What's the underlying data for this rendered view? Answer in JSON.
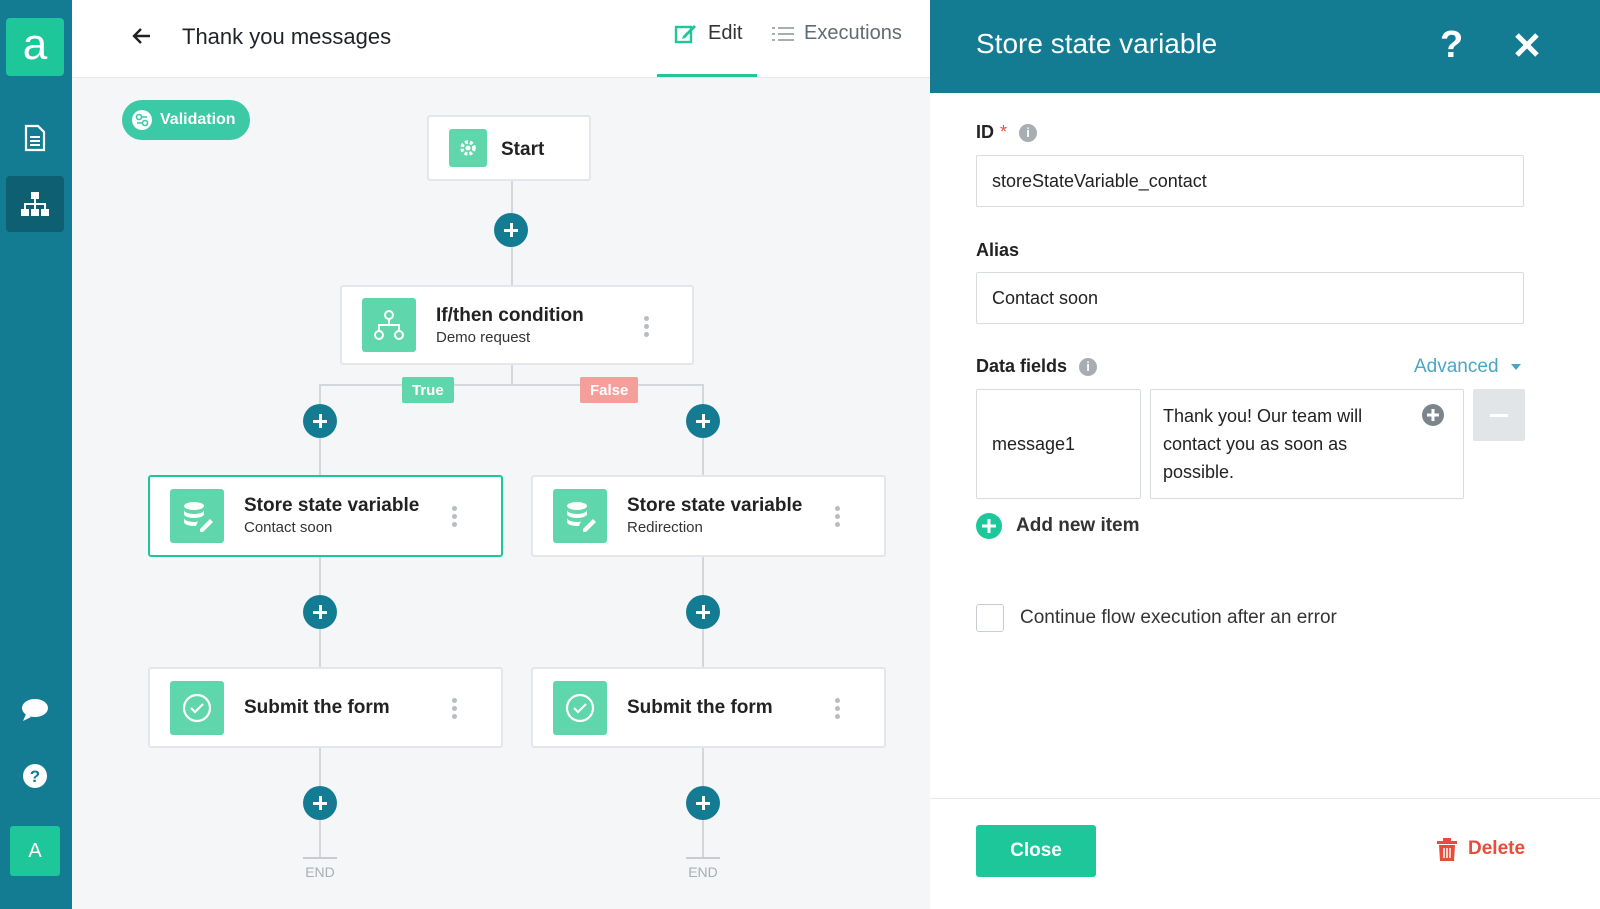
{
  "app": {
    "logo_letter": "a",
    "user_initial": "A"
  },
  "sidebar": {
    "items": [
      {
        "icon": "document-icon"
      },
      {
        "icon": "flow-icon",
        "active": true
      },
      {
        "icon": "chat-icon"
      },
      {
        "icon": "help-icon"
      }
    ]
  },
  "header": {
    "title": "Thank you messages",
    "tabs": [
      {
        "label": "Edit",
        "active": true
      },
      {
        "label": "Executions"
      }
    ]
  },
  "canvas": {
    "validation_label": "Validation",
    "start_label": "Start",
    "condition": {
      "title": "If/then condition",
      "subtitle": "Demo request"
    },
    "branch_true": "True",
    "branch_false": "False",
    "left_store": {
      "title": "Store state variable",
      "subtitle": "Contact soon"
    },
    "right_store": {
      "title": "Store state variable",
      "subtitle": "Redirection"
    },
    "left_submit": {
      "title": "Submit the form"
    },
    "right_submit": {
      "title": "Submit the form"
    },
    "end_label": "END"
  },
  "panel": {
    "title": "Store state variable",
    "id_label": "ID",
    "id_required": "*",
    "id_value": "storeStateVariable_contact",
    "alias_label": "Alias",
    "alias_value": "Contact soon",
    "data_fields_label": "Data fields",
    "advanced_label": "Advanced",
    "data_field": {
      "key": "message1",
      "value": "Thank you! Our team will contact you as soon as possible."
    },
    "add_item_label": "Add new item",
    "continue_label": "Continue flow execution after an error",
    "close_label": "Close",
    "delete_label": "Delete"
  },
  "colors": {
    "primary": "#137c93",
    "accent": "#1ec79a",
    "danger": "#e74c3c",
    "false_tag": "#f59f9a"
  }
}
